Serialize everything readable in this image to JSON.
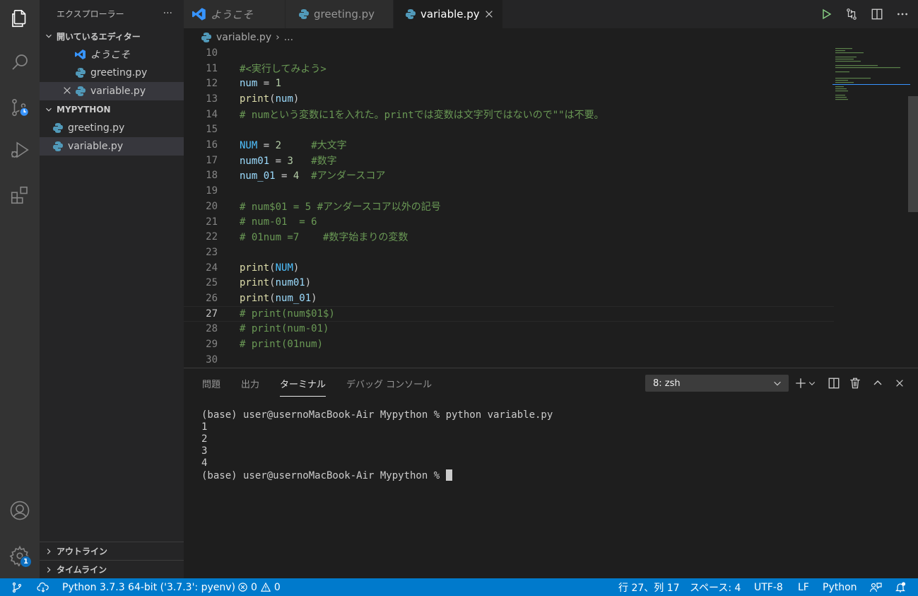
{
  "activity_bar": {
    "icons": [
      "files-icon",
      "search-icon",
      "source-control-icon",
      "run-debug-icon",
      "extensions-icon",
      "account-icon",
      "settings-gear-icon"
    ],
    "settings_badge": "1"
  },
  "sidebar": {
    "title": "エクスプローラー",
    "more": "···",
    "open_editors": {
      "title": "開いているエディター",
      "items": [
        {
          "label": "ようこそ",
          "icon": "vscode-icon"
        },
        {
          "label": "greeting.py",
          "icon": "python-icon"
        },
        {
          "label": "variable.py",
          "icon": "python-icon"
        }
      ]
    },
    "workspace": {
      "title": "MYPYTHON",
      "items": [
        {
          "label": "greeting.py",
          "icon": "python-icon"
        },
        {
          "label": "variable.py",
          "icon": "python-icon"
        }
      ]
    },
    "outline": "アウトライン",
    "timeline": "タイムライン"
  },
  "tabs": [
    {
      "label": "ようこそ",
      "icon": "vscode-icon"
    },
    {
      "label": "greeting.py",
      "icon": "python-icon"
    },
    {
      "label": "variable.py",
      "icon": "python-icon"
    }
  ],
  "breadcrumb": {
    "file": "variable.py",
    "sep": "›",
    "rest": "..."
  },
  "editor": {
    "lines": [
      {
        "n": "10",
        "text": ""
      },
      {
        "n": "11",
        "text": "#<実行してみよう>"
      },
      {
        "n": "12",
        "text": "num = 1"
      },
      {
        "n": "13",
        "text": "print(num)"
      },
      {
        "n": "14",
        "text": "# numという変数に1を入れた。printでは変数は文字列ではないので\"\"は不要。"
      },
      {
        "n": "15",
        "text": ""
      },
      {
        "n": "16",
        "text": "NUM = 2     #大文字"
      },
      {
        "n": "17",
        "text": "num01 = 3   #数字"
      },
      {
        "n": "18",
        "text": "num_01 = 4  #アンダースコア"
      },
      {
        "n": "19",
        "text": ""
      },
      {
        "n": "20",
        "text": "# num$01 = 5 #アンダースコア以外の記号"
      },
      {
        "n": "21",
        "text": "# num-01  = 6"
      },
      {
        "n": "22",
        "text": "# 01num =7    #数字始まりの変数"
      },
      {
        "n": "23",
        "text": ""
      },
      {
        "n": "24",
        "text": "print(NUM)"
      },
      {
        "n": "25",
        "text": "print(num01)"
      },
      {
        "n": "26",
        "text": "print(num_01)"
      },
      {
        "n": "27",
        "text": "# print(num$01$)"
      },
      {
        "n": "28",
        "text": "# print(num-01)"
      },
      {
        "n": "29",
        "text": "# print(01num)"
      },
      {
        "n": "30",
        "text": ""
      }
    ],
    "current_line": "27"
  },
  "panel": {
    "tabs": [
      "問題",
      "出力",
      "ターミナル",
      "デバッグ コンソール"
    ],
    "active_tab": "ターミナル",
    "terminal_select": "8: zsh",
    "terminal_lines": [
      "(base) user@usernoMacBook-Air Mypython % python variable.py",
      "1",
      "2",
      "3",
      "4"
    ],
    "prompt": "(base) user@usernoMacBook-Air Mypython % "
  },
  "statusbar": {
    "interpreter": "Python 3.7.3 64-bit ('3.7.3': pyenv)",
    "errors": "0",
    "warnings": "0",
    "position": "行 27、列 17",
    "spaces": "スペース: 4",
    "encoding": "UTF-8",
    "eol": "LF",
    "language": "Python"
  },
  "colors": {
    "accent": "#007acc",
    "comment": "#6a9955",
    "function": "#dcdcaa",
    "variable": "#9cdcfe",
    "number": "#b5cea8"
  }
}
